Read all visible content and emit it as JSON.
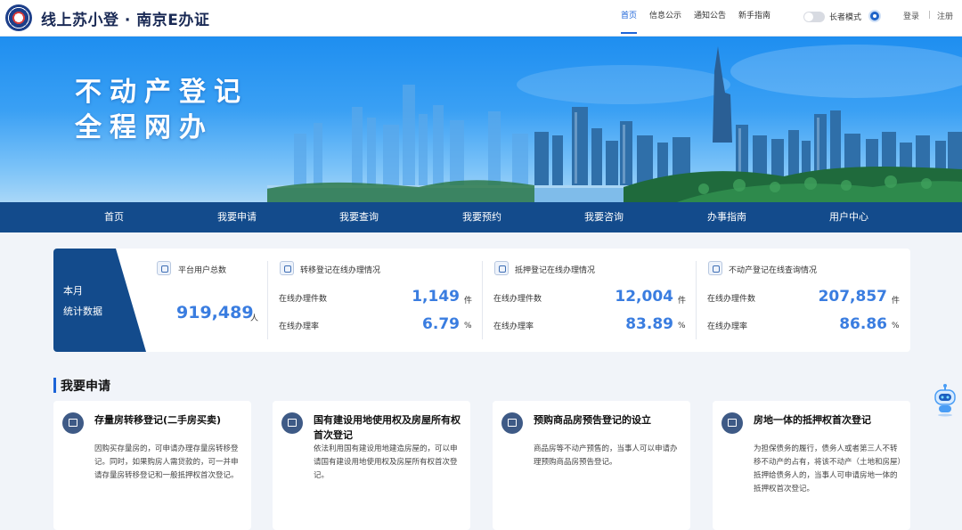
{
  "header": {
    "site_title": "线上苏小登 · 南京E办证",
    "nav": [
      {
        "label": "首页",
        "active": true
      },
      {
        "label": "信息公示",
        "active": false
      },
      {
        "label": "通知公告",
        "active": false
      },
      {
        "label": "新手指南",
        "active": false
      }
    ],
    "elder_mode_label": "长者模式",
    "elder_mode_on": false,
    "login": "登录",
    "separator": "|",
    "register": "注册"
  },
  "banner": {
    "line1": "不动产登记",
    "line2": "全程网办"
  },
  "main_nav": [
    "首页",
    "我要申请",
    "我要查询",
    "我要预约",
    "我要咨询",
    "办事指南",
    "用户中心"
  ],
  "stats": {
    "side_line1": "本月",
    "side_line2": "统计数据",
    "users": {
      "title": "平台用户总数",
      "value": "919,489",
      "unit": "人"
    },
    "groups": [
      {
        "title": "转移登记在线办理情况",
        "count_label": "在线办理件数",
        "count_value": "1,149",
        "count_unit": "件",
        "rate_label": "在线办理率",
        "rate_value": "6.79",
        "rate_unit": "%"
      },
      {
        "title": "抵押登记在线办理情况",
        "count_label": "在线办理件数",
        "count_value": "12,004",
        "count_unit": "件",
        "rate_label": "在线办理率",
        "rate_value": "83.89",
        "rate_unit": "%"
      },
      {
        "title": "不动产登记在线查询情况",
        "count_label": "在线办理件数",
        "count_value": "207,857",
        "count_unit": "件",
        "rate_label": "在线办理率",
        "rate_value": "86.86",
        "rate_unit": "%"
      }
    ]
  },
  "apply_section": {
    "title": "我要申请",
    "cards": [
      {
        "title": "存量房转移登记(二手房买卖)",
        "desc": "因购买存量房的，可申请办理存量房转移登记。同时，如果购房人需贷款的，可一并申请存量房转移登记和一般抵押权首次登记。"
      },
      {
        "title": "国有建设用地使用权及房屋所有权首次登记",
        "desc": "依法利用国有建设用地建造房屋的，可以申请国有建设用地使用权及房屋所有权首次登记。"
      },
      {
        "title": "预购商品房预告登记的设立",
        "desc": "商品房等不动产预售的，当事人可以申请办理预购商品房预告登记。"
      },
      {
        "title": "房地一体的抵押权首次登记",
        "desc": "为担保债务的履行，债务人或者第三人不转移不动产的占有，将该不动产（土地和房屋）抵押给债务人的，当事人可申请房地一体的抵押权首次登记。"
      }
    ]
  },
  "colors": {
    "brand_blue": "#1c64d8",
    "nav_navy": "#134b8c",
    "number_blue": "#3a7de0"
  }
}
